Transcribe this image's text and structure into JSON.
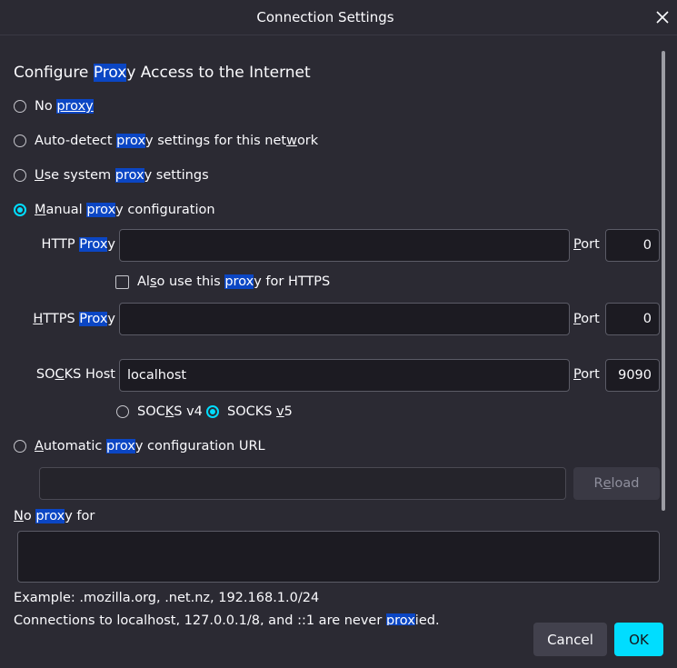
{
  "window": {
    "title": "Connection Settings",
    "close_icon": "close-icon"
  },
  "heading": {
    "pre": "Configure ",
    "hl": "Prox",
    "post": "y Access to the Internet"
  },
  "modes": {
    "no_proxy": {
      "a": "No ",
      "hl": "proxy",
      "b": "",
      "selected": false
    },
    "auto_detect": {
      "a": "Auto-detect ",
      "hl": "prox",
      "b": "y settings for this net",
      "u": "w",
      "c": "ork",
      "selected": false
    },
    "system": {
      "u": "U",
      "a": "se system ",
      "hl": "prox",
      "b": "y settings",
      "selected": false
    },
    "manual": {
      "u": "M",
      "a": "anual ",
      "hl": "prox",
      "b": "y configuration",
      "selected": true
    },
    "pac": {
      "u": "A",
      "a": "utomatic ",
      "hl": "prox",
      "b": "y configuration URL",
      "selected": false
    }
  },
  "manual": {
    "http": {
      "pre": "HTTP ",
      "hl": "Prox",
      "post": "y",
      "value": "",
      "port_label_u": "P",
      "port_label_rest": "ort",
      "port": "0"
    },
    "also_https": {
      "pre": "Al",
      "u": "s",
      "mid": "o use this ",
      "hl": "prox",
      "post": "y for HTTPS",
      "checked": false
    },
    "https": {
      "u": "H",
      "pre": "TTPS ",
      "hl": "Prox",
      "post": "y",
      "value": "",
      "port_label_u": "P",
      "port_label_rest": "ort",
      "port": "0"
    },
    "socks": {
      "pre": "SO",
      "u": "C",
      "post": "KS Host",
      "value": "localhost",
      "port_label_u": "P",
      "port_label_rest": "ort",
      "port": "9090"
    },
    "socks_v4": {
      "pre": "SOC",
      "u": "K",
      "post": "S v4",
      "selected": false
    },
    "socks_v5": {
      "pre": "SOCKS ",
      "u": "v",
      "post": "5",
      "selected": true
    }
  },
  "pac": {
    "url": "",
    "reload_pre": "R",
    "reload_u": "e",
    "reload_post": "load"
  },
  "no_proxy_for": {
    "u": "N",
    "a": "o ",
    "hl": "prox",
    "b": "y for",
    "value": "",
    "example": "Example: .mozilla.org, .net.nz, 192.168.1.0/24",
    "note_pre": "Connections to localhost, 127.0.0.1/8, and ::1 are never ",
    "note_hl": "prox",
    "note_post": "ied."
  },
  "buttons": {
    "cancel": "Cancel",
    "ok": "OK"
  },
  "colors": {
    "background": "#2b2a33",
    "accent": "#00ddff",
    "highlight": "#0b46c4",
    "field": "#1c1b22"
  }
}
